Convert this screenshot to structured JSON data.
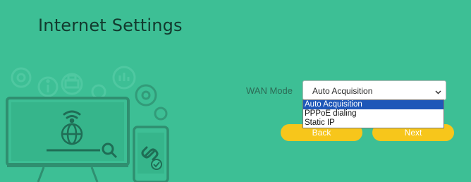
{
  "page": {
    "title": "Internet Settings"
  },
  "wan": {
    "label": "WAN Mode",
    "selected": "Auto Acquisition",
    "arrow": "⌄",
    "options": [
      "Auto Acquisition",
      "PPPoE dialing",
      "Static IP"
    ]
  },
  "buttons": {
    "back": "Back",
    "next": "Next"
  },
  "colors": {
    "background": "#3dbf95",
    "button": "#f7c61b",
    "option_highlight": "#1e57b8"
  },
  "illustration_icons": [
    "gear-icon",
    "info-icon",
    "printer-icon",
    "chart-icon",
    "monitor-icon",
    "wifi-icon",
    "globe-icon",
    "magnifier-icon",
    "phone-icon",
    "link-icon",
    "shield-check-icon"
  ]
}
